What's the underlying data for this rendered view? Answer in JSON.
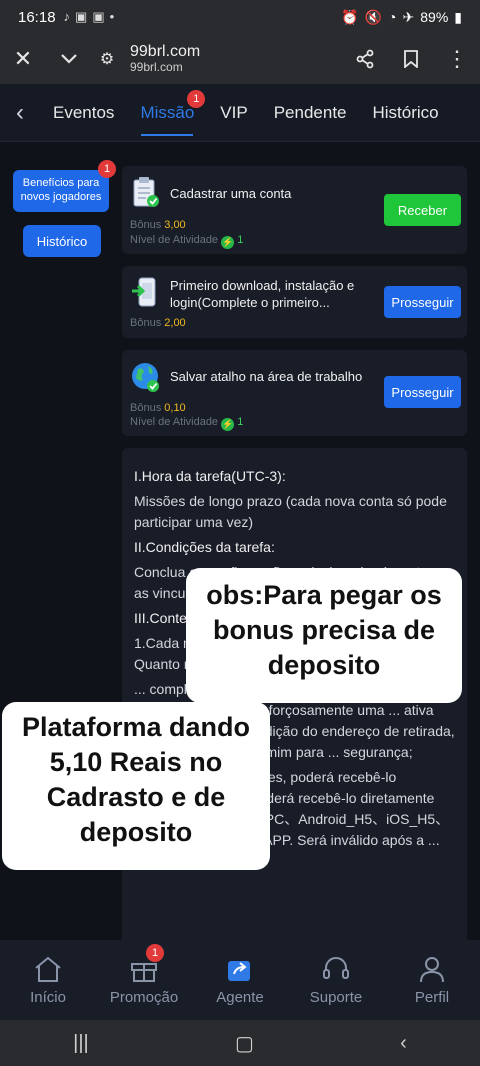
{
  "status_bar": {
    "time": "16:18",
    "battery": "89%"
  },
  "browser": {
    "domain": "99brl.com",
    "subdomain": "99brl.com"
  },
  "tabs": [
    {
      "label": "Eventos"
    },
    {
      "label": "Missão",
      "badge": "1"
    },
    {
      "label": "VIP"
    },
    {
      "label": "Pendente"
    },
    {
      "label": "Histórico"
    }
  ],
  "left": {
    "benefits_label": "Benefícios para novos jogadores",
    "benefits_badge": "1",
    "history_label": "Histórico"
  },
  "tasks": [
    {
      "title": "Cadastrar uma conta",
      "bonus_label": "Bônus",
      "bonus": "3,00",
      "level_label": "Nível de Atividade",
      "level": "1",
      "action": "Receber"
    },
    {
      "title": "Primeiro download, instalação e login(Complete o primeiro...",
      "bonus_label": "Bônus",
      "bonus": "2,00",
      "action": "Prosseguir"
    },
    {
      "title": "Salvar atalho na área de trabalho",
      "bonus_label": "Bônus",
      "bonus": "0,10",
      "level_label": "Nível de Atividade",
      "level": "1",
      "action": "Prosseguir"
    }
  ],
  "rules": {
    "h1": "I.Hora da tarefa(UTC-3):",
    "p1": "Missões de longo prazo (cada nova conta só pode participar uma vez)",
    "h2": "II.Condições da tarefa:",
    "p2": "Conclua as configurações relacionadas à conta e as vinculações...",
    "h3": "III.Conteúdo da tarefa:",
    "p3": "1.Cada missão ... tarefas acima, ... valor de bônus. Quanto maior ... maior a recompensa;",
    "p4": "... completamente anônima, ... perda de fundos não será ... isso exigimos forçosamente uma ... ativa em duas etapas, ... adição do endereço de retirada, ... idamente feito por mim para ... segurança;",
    "p5": "... atender às condições, poderá recebê-lo diretamente. Você poderá recebê-lo diretamente em qualquer final de PC、Android_H5、iOS_H5、Android_APP、iOS_APP. Será inválido após a ..."
  },
  "overlays": {
    "right": "obs:Para pegar os bonus precisa de deposito",
    "left": "Plataforma dando 5,10 Reais no Cadrasto e de deposito"
  },
  "bottom_nav": [
    {
      "label": "Início"
    },
    {
      "label": "Promoção",
      "badge": "1"
    },
    {
      "label": "Agente"
    },
    {
      "label": "Suporte"
    },
    {
      "label": "Perfil"
    }
  ]
}
